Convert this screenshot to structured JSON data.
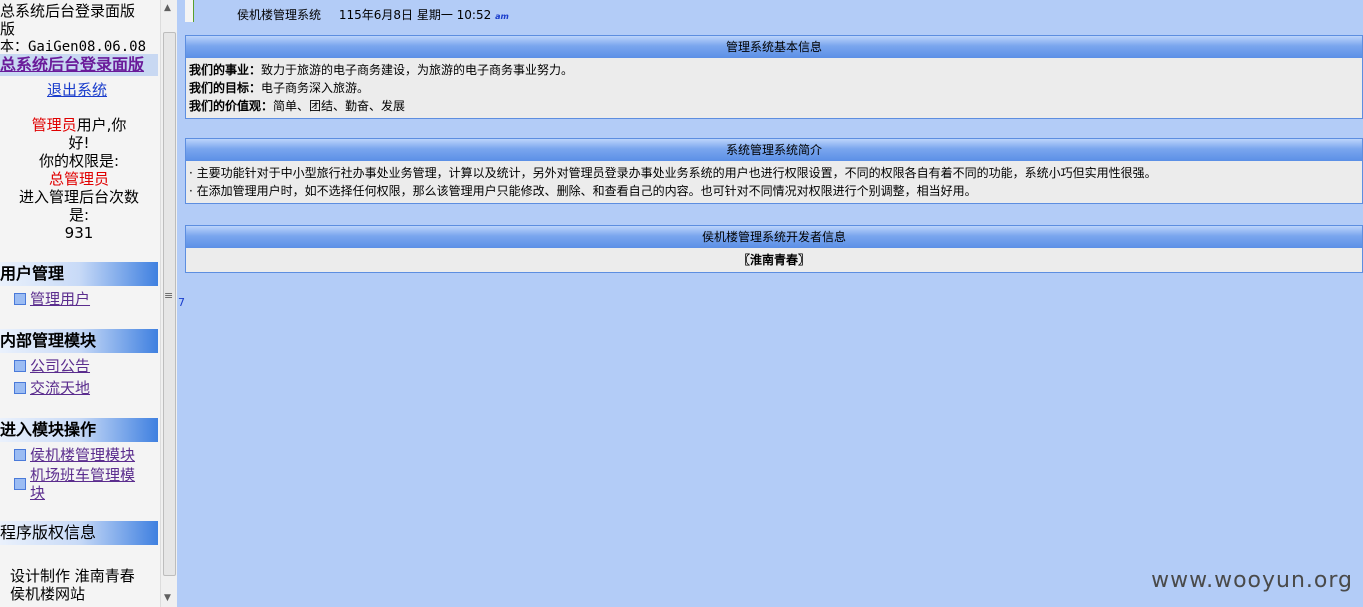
{
  "sidebar": {
    "title_line1": "总系统后台登录面版",
    "title_line2": "版",
    "version": "本：GaiGen08.06.08",
    "home_link": "总系统后台登录面版",
    "logout_link": "退出系统",
    "role_prefix": "管理员",
    "greeting_suffix": "用户,你",
    "greeting_line2": "好!",
    "permission_label": "你的权限是:",
    "permission_value": "总管理员",
    "login_count_label_1": "进入管理后台次数",
    "login_count_label_2": "是:",
    "login_count": "931",
    "sections": [
      {
        "title": "用户管理",
        "items": [
          "管理用户"
        ]
      },
      {
        "title": "内部管理模块",
        "items": [
          "公司公告",
          "交流天地"
        ]
      },
      {
        "title": "进入模块操作",
        "items": [
          "侯机楼管理模块",
          "机场班车管理模块"
        ]
      },
      {
        "title": "程序版权信息",
        "items": []
      }
    ],
    "credit_line1": "设计制作  淮南青春",
    "credit_line2": "侯机楼网站"
  },
  "divider": {
    "grip": "≡",
    "marker": "7"
  },
  "topbar": {
    "system_name": "侯机楼管理系统",
    "date": "115年6月8日 星期一 10:52",
    "ampm": "am"
  },
  "panels": {
    "basic_info": {
      "title": "管理系统基本信息",
      "rows": [
        {
          "label": "我们的事业：",
          "text": "致力于旅游的电子商务建设，为旅游的电子商务事业努力。"
        },
        {
          "label": "我们的目标：",
          "text": "电子商务深入旅游。"
        },
        {
          "label": "我们的价值观：",
          "text": "简单、团结、勤奋、发展"
        }
      ]
    },
    "intro": {
      "title": "系统管理系统简介",
      "lines": [
        "· 主要功能针对于中小型旅行社办事处业务管理，计算以及统计，另外对管理员登录办事处业务系统的用户也进行权限设置，不同的权限各自有着不同的功能，系统小巧但实用性很强。",
        "· 在添加管理用户时，如不选择任何权限，那么该管理用户只能修改、删除、和查看自己的内容。也可针对不同情况对权限进行个别调整，相当好用。"
      ]
    },
    "developer": {
      "title": "侯机楼管理系统开发者信息",
      "name": "〖淮南青春〗"
    }
  },
  "watermark": "www.wooyun.org",
  "colors": {
    "background": "#b3ccf7",
    "role": "#e00000",
    "link": "#5b2d8e",
    "home_link": "#6a1b9a",
    "logout": "#1a3dcc"
  }
}
